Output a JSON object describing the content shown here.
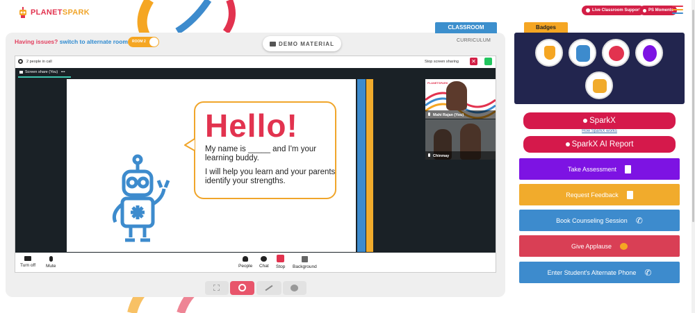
{
  "header": {
    "logo_text_a": "PLANET",
    "logo_text_b": "SPARK",
    "live_support_label": "Live Classroom Support",
    "ps_moments_label": "PS Moments"
  },
  "room": {
    "issue_text": "Having issues?",
    "switch_link": "switch to alternate room",
    "room_toggle_label": "ROOM 2",
    "demo_material_label": "DEMO MATERIAL",
    "classroom_tab": "CLASSROOM",
    "curriculum_tab": "CURRICULUM"
  },
  "call": {
    "people_count": "2 people in call",
    "stop_sharing_label": "Stop screen sharing",
    "screen_share_tab": "Screen share (You)",
    "tab_more": "•••"
  },
  "slide": {
    "hello": "Hello!",
    "line1": "My name is _____ and I'm your learning buddy.",
    "line2": "I will help you learn and your parents identify your strengths.",
    "mini_logo": "PLANETSPARK"
  },
  "participants": [
    {
      "name": "Mahi Rajan (You)"
    },
    {
      "name": "Chinmay"
    }
  ],
  "controls": {
    "turn_off": "Turn off",
    "mute": "Mute",
    "people": "People",
    "chat": "Chat",
    "stop": "Stop",
    "background": "Background"
  },
  "sidebar": {
    "badges_label": "Badges",
    "sparkx_label": "SparkX",
    "sparkx_link": "How SparkX works",
    "sparkx_report_label": "SparkX AI Report",
    "actions": [
      {
        "label": "Take Assessment",
        "color": "#7d13e3"
      },
      {
        "label": "Request Feedback",
        "color": "#f1ab2c"
      },
      {
        "label": "Book Counseling Session",
        "color": "#3d8bcd"
      },
      {
        "label": "Give Applause",
        "color": "#d93f55"
      },
      {
        "label": "Enter Student's Alternate Phone",
        "color": "#3d8bcd"
      }
    ]
  },
  "colors": {
    "brand_red": "#d31f46",
    "classroom_blue": "#3c8fcd",
    "badge_orange": "#f5a623",
    "badges_panel": "#22254e"
  }
}
